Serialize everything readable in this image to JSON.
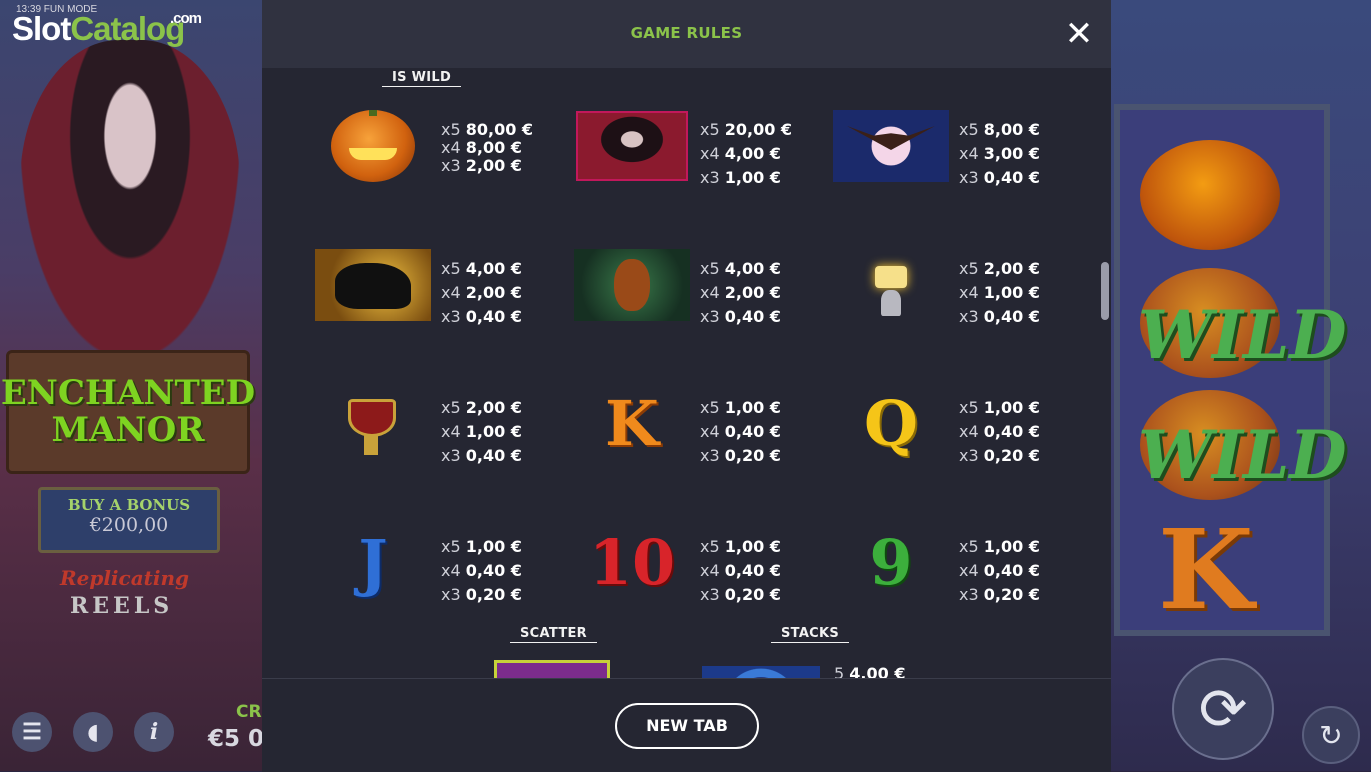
{
  "background": {
    "logo": {
      "slot": "Slot",
      "catalog": "Catalog",
      "dotcom": ".com"
    },
    "status": "13:39  FUN MODE",
    "game_title_line1": "ENCHANTED",
    "game_title_line2": "MANOR",
    "buy_bonus": {
      "label": "BUY A BONUS",
      "price": "€200,00"
    },
    "replicating": "Replicating",
    "reels": "REELS",
    "credit_label": "CR",
    "credit_value": "€5 0",
    "wild_1": "WILD",
    "wild_2": "WILD",
    "reel_letter": "K"
  },
  "modal": {
    "title": "GAME RULES",
    "close_icon": "close-icon",
    "new_tab_label": "NEW TAB",
    "is_wild_label": "IS WILD",
    "scatter_label": "SCATTER",
    "stacks_label": "STACKS",
    "stacks_partial": {
      "mult": "5",
      "amount": "4,00 €"
    }
  },
  "paytable": [
    {
      "symbol": "pumpkin",
      "pays": [
        {
          "m": "x5",
          "a": "80,00 €"
        },
        {
          "m": "x4",
          "a": "8,00 €"
        },
        {
          "m": "x3",
          "a": "2,00 €"
        }
      ]
    },
    {
      "symbol": "vampire-woman",
      "pays": [
        {
          "m": "x5",
          "a": "20,00 €"
        },
        {
          "m": "x4",
          "a": "4,00 €"
        },
        {
          "m": "x3",
          "a": "1,00 €"
        }
      ]
    },
    {
      "symbol": "bat",
      "pays": [
        {
          "m": "x5",
          "a": "8,00 €"
        },
        {
          "m": "x4",
          "a": "3,00 €"
        },
        {
          "m": "x3",
          "a": "0,40 €"
        }
      ]
    },
    {
      "symbol": "black-cat",
      "pays": [
        {
          "m": "x5",
          "a": "4,00 €"
        },
        {
          "m": "x4",
          "a": "2,00 €"
        },
        {
          "m": "x3",
          "a": "0,40 €"
        }
      ]
    },
    {
      "symbol": "owl",
      "pays": [
        {
          "m": "x5",
          "a": "4,00 €"
        },
        {
          "m": "x4",
          "a": "2,00 €"
        },
        {
          "m": "x3",
          "a": "0,40 €"
        }
      ]
    },
    {
      "symbol": "candelabra",
      "pays": [
        {
          "m": "x5",
          "a": "2,00 €"
        },
        {
          "m": "x4",
          "a": "1,00 €"
        },
        {
          "m": "x3",
          "a": "0,40 €"
        }
      ]
    },
    {
      "symbol": "goblet",
      "pays": [
        {
          "m": "x5",
          "a": "2,00 €"
        },
        {
          "m": "x4",
          "a": "1,00 €"
        },
        {
          "m": "x3",
          "a": "0,40 €"
        }
      ]
    },
    {
      "symbol": "K",
      "pays": [
        {
          "m": "x5",
          "a": "1,00 €"
        },
        {
          "m": "x4",
          "a": "0,40 €"
        },
        {
          "m": "x3",
          "a": "0,20 €"
        }
      ]
    },
    {
      "symbol": "Q",
      "pays": [
        {
          "m": "x5",
          "a": "1,00 €"
        },
        {
          "m": "x4",
          "a": "0,40 €"
        },
        {
          "m": "x3",
          "a": "0,20 €"
        }
      ]
    },
    {
      "symbol": "J",
      "pays": [
        {
          "m": "x5",
          "a": "1,00 €"
        },
        {
          "m": "x4",
          "a": "0,40 €"
        },
        {
          "m": "x3",
          "a": "0,20 €"
        }
      ]
    },
    {
      "symbol": "10",
      "pays": [
        {
          "m": "x5",
          "a": "1,00 €"
        },
        {
          "m": "x4",
          "a": "0,40 €"
        },
        {
          "m": "x3",
          "a": "0,20 €"
        }
      ]
    },
    {
      "symbol": "9",
      "pays": [
        {
          "m": "x5",
          "a": "1,00 €"
        },
        {
          "m": "x4",
          "a": "0,40 €"
        },
        {
          "m": "x3",
          "a": "0,20 €"
        }
      ]
    }
  ],
  "colors": {
    "accent_green": "#8bc34a",
    "modal_bg": "#252632",
    "header_bg": "#303240"
  }
}
